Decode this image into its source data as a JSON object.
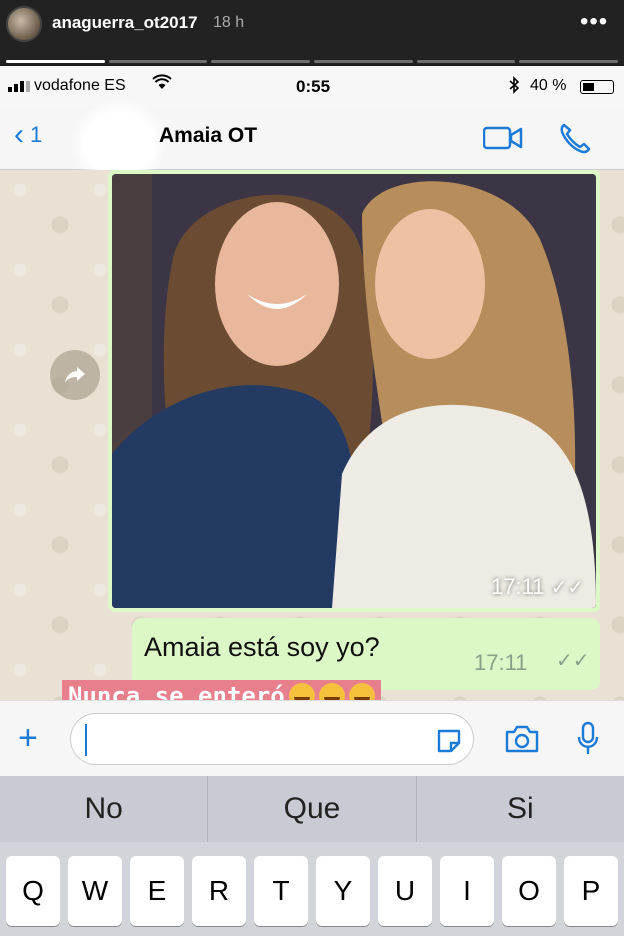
{
  "story": {
    "username": "anaguerra_ot2017",
    "time_ago": "18 h",
    "more_label": "•••",
    "segments": 6,
    "current_segment": 1
  },
  "status_bar": {
    "carrier": "vodafone ES",
    "time": "0:55",
    "battery": "40 %",
    "battery_level": 0.4
  },
  "chat_header": {
    "back_label": "‹",
    "back_count": "1",
    "contact_name": "Amaia OT",
    "accent": "#1d7bd8"
  },
  "messages": [
    {
      "type": "photo",
      "time": "17:11",
      "ticks": "✓✓"
    },
    {
      "type": "text",
      "text": "Amaia está soy yo?",
      "time": "17:11",
      "ticks": "✓✓"
    }
  ],
  "caption": {
    "text": "Nunca se enteró",
    "emoji_count": 3,
    "emoji": "laughing-tears-emoji"
  },
  "input": {
    "plus_label": "+",
    "placeholder": ""
  },
  "keyboard": {
    "suggestions": [
      "No",
      "Que",
      "Si"
    ],
    "row1": [
      "Q",
      "W",
      "E",
      "R",
      "T",
      "Y",
      "U",
      "I",
      "O",
      "P"
    ]
  }
}
